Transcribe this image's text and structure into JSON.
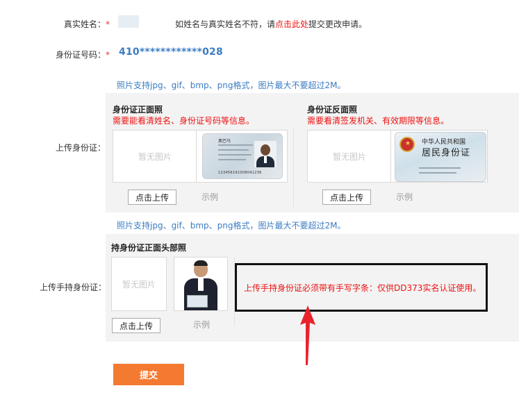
{
  "real_name": {
    "label": "真实姓名：",
    "required_mark": "*",
    "hint_prefix": "如姓名与真实姓名不符，请",
    "hint_link": "点击此处",
    "hint_suffix": "提交更改申请。"
  },
  "id_number": {
    "label": "身份证号码：",
    "required_mark": "*",
    "value": "410************028"
  },
  "upload_id": {
    "note": "照片支持jpg、gif、bmp、png格式，图片最大不要超过2M。",
    "label": "上传身份证：",
    "front": {
      "title": "身份证正面照",
      "note": "需要能看清姓名、身份证号码等信息。",
      "placeholder": "暂无图片",
      "upload_button": "点击上传",
      "sample_label": "示例",
      "card": {
        "name": "奥巴马",
        "number": "123456191008041236"
      }
    },
    "back": {
      "title": "身份证反面照",
      "note": "需要看清签发机关、有效期限等信息。",
      "placeholder": "暂无图片",
      "upload_button": "点击上传",
      "sample_label": "示例",
      "card": {
        "country": "中华人民共和国",
        "title": "居民身份证"
      }
    }
  },
  "upload_handheld": {
    "note": "照片支持jpg、gif、bmp、png格式，图片最大不要超过2M。",
    "label": "上传手持身份证：",
    "title": "持身份证正面头部照",
    "placeholder": "暂无图片",
    "upload_button": "点击上传",
    "sample_label": "示例",
    "warning": "上传手持身份证必须带有手写字条：仅供DD373实名认证使用。"
  },
  "submit_label": "提交",
  "colors": {
    "accent_blue": "#3b7cc2",
    "alert_red": "#e11111",
    "submit_orange": "#f47a32",
    "panel_gray": "#f3f3f3"
  }
}
